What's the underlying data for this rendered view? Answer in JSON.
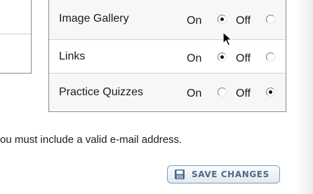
{
  "options": [
    {
      "label": "Image Gallery",
      "on_label": "On",
      "off_label": "Off",
      "selected": "on"
    },
    {
      "label": "Links",
      "on_label": "On",
      "off_label": "Off",
      "selected": "on"
    },
    {
      "label": "Practice Quizzes",
      "on_label": "On",
      "off_label": "Off",
      "selected": "off"
    }
  ],
  "notice": "ou must include a valid e-mail address.",
  "save_button": {
    "label": "SAVE CHANGES",
    "icon": "floppy-disk-icon"
  },
  "colors": {
    "button_text": "#4a6a88",
    "button_border": "#7f9bb5",
    "table_border": "#8a8a8a"
  }
}
